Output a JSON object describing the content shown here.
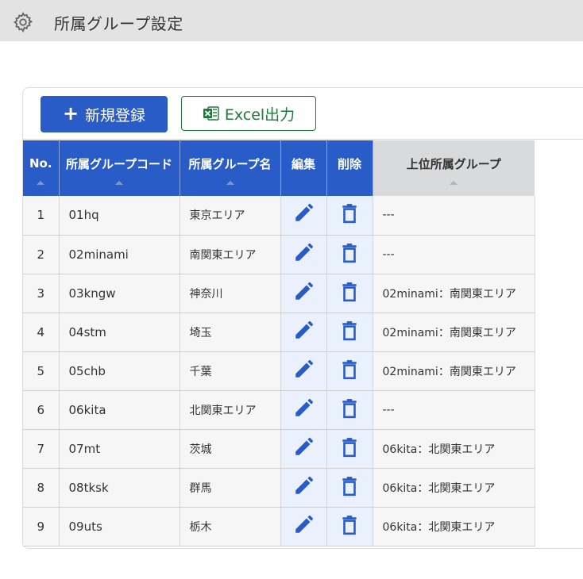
{
  "header": {
    "title": "所属グループ設定",
    "icon": "gear-icon"
  },
  "toolbar": {
    "new_label": "新規登録",
    "excel_label": "Excel出力"
  },
  "table": {
    "columns": {
      "no": "No.",
      "code": "所属グループコード",
      "name": "所属グループ名",
      "edit": "編集",
      "delete": "削除",
      "parent": "上位所属グループ"
    },
    "rows": [
      {
        "no": "1",
        "code": "01hq",
        "name": "東京エリア",
        "parent": "---"
      },
      {
        "no": "2",
        "code": "02minami",
        "name": "南関東エリア",
        "parent": "---"
      },
      {
        "no": "3",
        "code": "03kngw",
        "name": "神奈川",
        "parent": "02minami：南関東エリア"
      },
      {
        "no": "4",
        "code": "04stm",
        "name": "埼玉",
        "parent": "02minami：南関東エリア"
      },
      {
        "no": "5",
        "code": "05chb",
        "name": "千葉",
        "parent": "02minami：南関東エリア"
      },
      {
        "no": "6",
        "code": "06kita",
        "name": "北関東エリア",
        "parent": "---"
      },
      {
        "no": "7",
        "code": "07mt",
        "name": "茨城",
        "parent": "06kita：北関東エリア"
      },
      {
        "no": "8",
        "code": "08tksk",
        "name": "群馬",
        "parent": "06kita：北関東エリア"
      },
      {
        "no": "9",
        "code": "09uts",
        "name": "栃木",
        "parent": "06kita：北関東エリア"
      }
    ]
  },
  "colors": {
    "primary": "#2a5cc7",
    "excel_green": "#1e7a3a",
    "header_bg": "#e3e3e3"
  }
}
